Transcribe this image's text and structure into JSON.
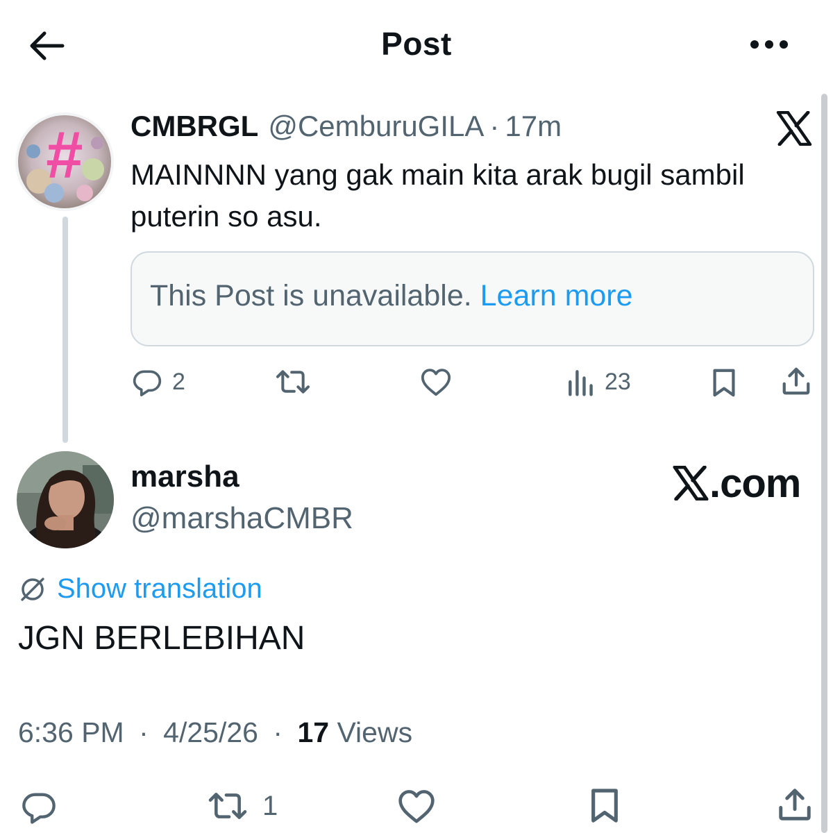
{
  "header": {
    "title": "Post"
  },
  "parent_post": {
    "author_name": "CMBRGL",
    "author_handle": "@CemburuGILA",
    "separator": "·",
    "time": "17m",
    "text": "MAINNNN yang gak main kita arak bugil sambil puterin so asu.",
    "quote": {
      "message": "This Post is unavailable.",
      "link": "Learn more"
    },
    "actions": {
      "replies": "2",
      "views": "23"
    }
  },
  "reply_post": {
    "author_name": "marsha",
    "author_handle": "@marshaCMBR",
    "watermark": ".com",
    "translate_label": "Show translation",
    "text": "JGN BERLEBIHAN",
    "timestamp": "6:36 PM",
    "separator": "·",
    "date": "4/25/26",
    "views_count": "17",
    "views_label": "Views",
    "reposts": "1"
  },
  "colors": {
    "text": "#0f1419",
    "secondary": "#536471",
    "link": "#1d9bf0",
    "border": "#cfd9de"
  },
  "icons": [
    "back-arrow-icon",
    "more-dots-icon",
    "x-logo-icon",
    "reply-icon",
    "repost-icon",
    "like-icon",
    "views-icon",
    "bookmark-icon",
    "share-icon",
    "translate-icon"
  ]
}
